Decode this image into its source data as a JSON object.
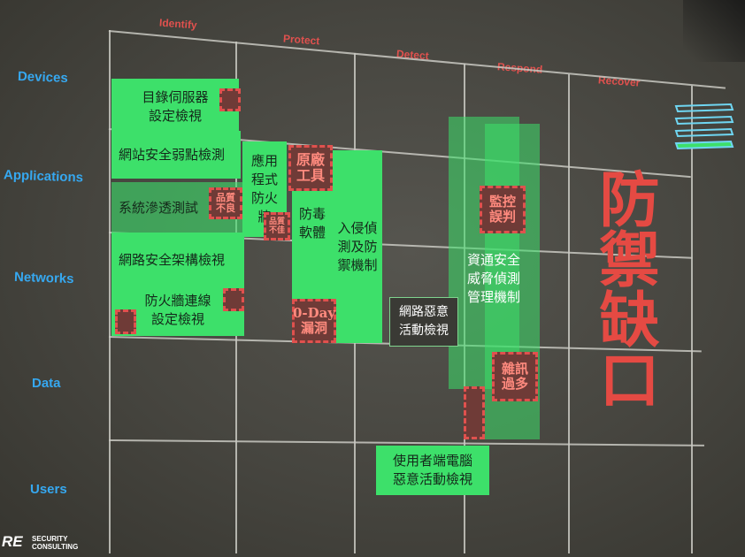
{
  "columns": [
    "Identify",
    "Protect",
    "Detect",
    "Respond",
    "Recover"
  ],
  "rows": [
    "Devices",
    "Applications",
    "Networks",
    "Data",
    "Users"
  ],
  "solutions": {
    "server_config_review": "目錄伺服器\n設定檢視",
    "web_vuln_scan": "網站安全弱點檢測",
    "pentest": "系統滲透測試",
    "app_firewall": "應用\n程式\n防火\n牆",
    "network_arch_review": "網路安全架構檢視",
    "firewall_rules_review": "防火牆連線\n設定檢視",
    "antivirus": "防毒\n軟體",
    "ids_ips": "入侵偵\n測及防\n禦機制",
    "network_activity_review": "網路惡意\n活動檢視",
    "threat_detection": "資通安全\n威脅偵測\n管理機制",
    "endpoint_activity_review": "使用者端電腦\n惡意活動檢視"
  },
  "gaps": {
    "quality_poor_1": "品質\n不良",
    "quality_poor_2": "品質\n不佳",
    "source_tools": "原廠\n工具",
    "zero_day": "0-Day\n漏洞",
    "monitor_misjudge": "監控\n誤判",
    "too_many_alerts": "雜訊\n過多"
  },
  "defense_gap_label": "防禦缺口",
  "logo": {
    "brand": "RE",
    "tagline_1": "SECURITY",
    "tagline_2": "CONSULTING"
  },
  "colors": {
    "solution": "#3de06a",
    "gap_border": "#e0514e",
    "header_col": "#e0514e",
    "header_row": "#36a8f0",
    "big_text": "#e54a43"
  }
}
